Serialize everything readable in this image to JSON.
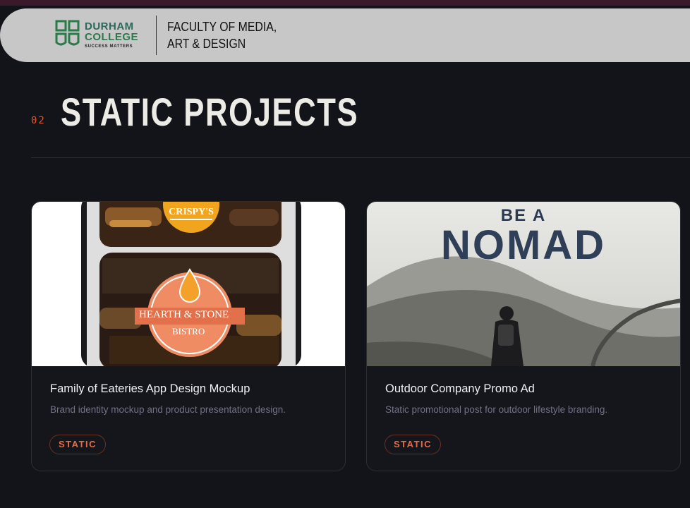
{
  "header": {
    "logo": {
      "line1": "DURHAM",
      "line2": "COLLEGE",
      "tagline": "SUCCESS MATTERS",
      "colors": {
        "teal": "#2a6a5a",
        "green": "#2a7a4a"
      }
    },
    "faculty_line1": "FACULTY OF MEDIA,",
    "faculty_line2": "ART & DESIGN"
  },
  "section": {
    "number": "02",
    "title": "STATIC PROJECTS",
    "accent_color": "#e2552b"
  },
  "projects": [
    {
      "title": "Family of Eateries App Design Mockup",
      "description": "Brand identity mockup and product presentation design.",
      "tag": "STATIC",
      "image": {
        "brand_top": "CRISPY'S",
        "brand_line1": "HEARTH & STONE",
        "brand_line2": "BISTRO"
      }
    },
    {
      "title": "Outdoor Company Promo Ad",
      "description": "Static promotional post for outdoor lifestyle branding.",
      "tag": "STATIC",
      "image": {
        "headline_small": "BE A",
        "headline_big": "NOMAD"
      }
    }
  ]
}
